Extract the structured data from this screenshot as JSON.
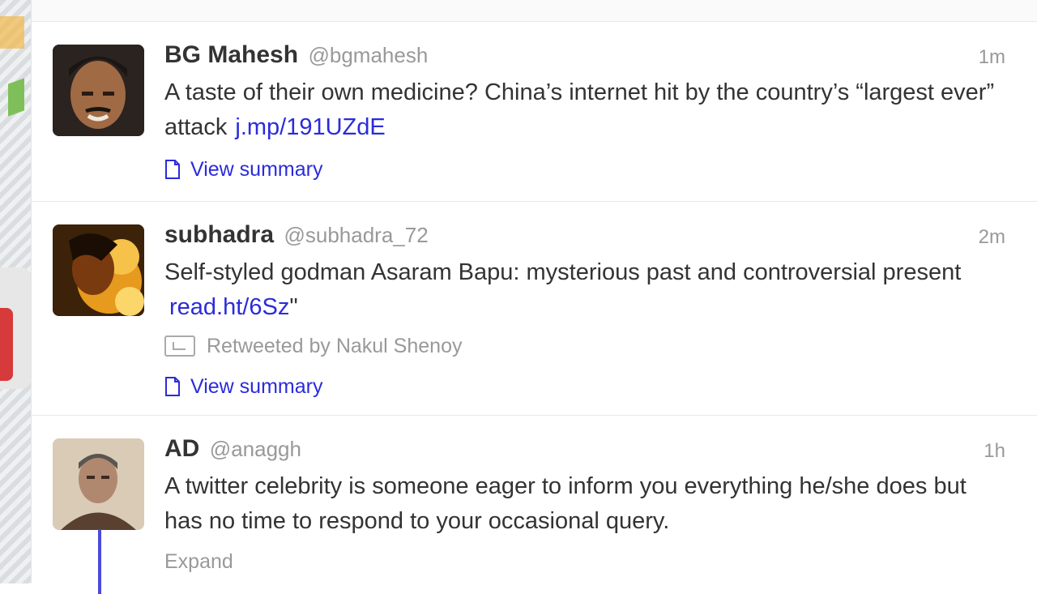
{
  "tweets": [
    {
      "name": "BG Mahesh",
      "handle": "@bgmahesh",
      "time": "1m",
      "text_before": "A taste of their own medicine? China’s internet hit by the country’s “largest ever” attack",
      "link": "j.mp/191UZdE",
      "action_label": "View summary"
    },
    {
      "name": "subhadra",
      "handle": "@subhadra_72",
      "time": "2m",
      "text_before": "Self-styled godman Asaram Bapu: mysterious past and controversial present",
      "link": "read.ht/6Sz",
      "text_after": "\"",
      "retweeted_by": "Retweeted by Nakul Shenoy",
      "action_label": "View summary"
    },
    {
      "name": "AD",
      "handle": "@anaggh",
      "time": "1h",
      "text_before": "A twitter celebrity is someone eager to inform you everything he/she does but has no time to respond to your occasional query.",
      "expand_label": "Expand"
    }
  ],
  "colors": {
    "link": "#2b2bdb",
    "muted": "#999999",
    "text": "#333333"
  }
}
